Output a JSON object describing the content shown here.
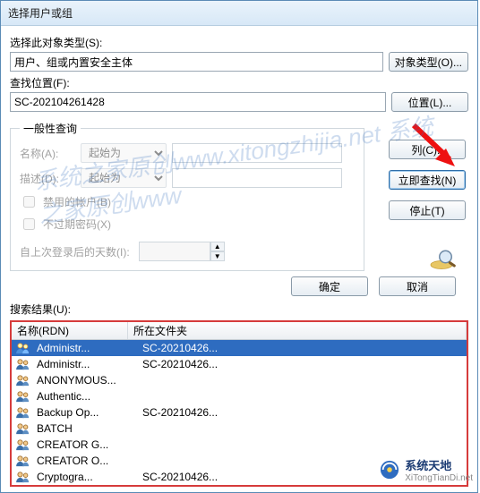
{
  "window": {
    "title": "选择用户或组"
  },
  "objectType": {
    "label": "选择此对象类型(S):",
    "value": "用户、组或内置安全主体",
    "button": "对象类型(O)..."
  },
  "location": {
    "label": "查找位置(F):",
    "value": "SC-202104261428",
    "button": "位置(L)..."
  },
  "query": {
    "legend": "一般性查询",
    "nameLabel": "名称(A):",
    "nameMode": "起始为",
    "descLabel": "描述(D):",
    "descMode": "起始为",
    "chkDisabled": "禁用的帐户(B)",
    "chkNoExpire": "不过期密码(X)",
    "lastLogonLabel": "自上次登录后的天数(I):"
  },
  "sideButtons": {
    "columns": "列(C)..",
    "findNow": "立即查找(N)",
    "stop": "停止(T)"
  },
  "actions": {
    "ok": "确定",
    "cancel": "取消"
  },
  "results": {
    "label": "搜索结果(U):",
    "colName": "名称(RDN)",
    "colLocation": "所在文件夹",
    "rows": [
      {
        "name": "Administr...",
        "loc": "SC-20210426..."
      },
      {
        "name": "Administr...",
        "loc": "SC-20210426..."
      },
      {
        "name": "ANONYMOUS...",
        "loc": ""
      },
      {
        "name": "Authentic...",
        "loc": ""
      },
      {
        "name": "Backup Op...",
        "loc": "SC-20210426..."
      },
      {
        "name": "BATCH",
        "loc": ""
      },
      {
        "name": "CREATOR G...",
        "loc": ""
      },
      {
        "name": "CREATOR O...",
        "loc": ""
      },
      {
        "name": "Cryptogra...",
        "loc": "SC-20210426..."
      }
    ]
  },
  "watermark": "系统之家原创www.xitongzhijia.net 系统之家原创www",
  "brand": {
    "name": "系统天地",
    "url": "XiTongTianDi.net"
  }
}
